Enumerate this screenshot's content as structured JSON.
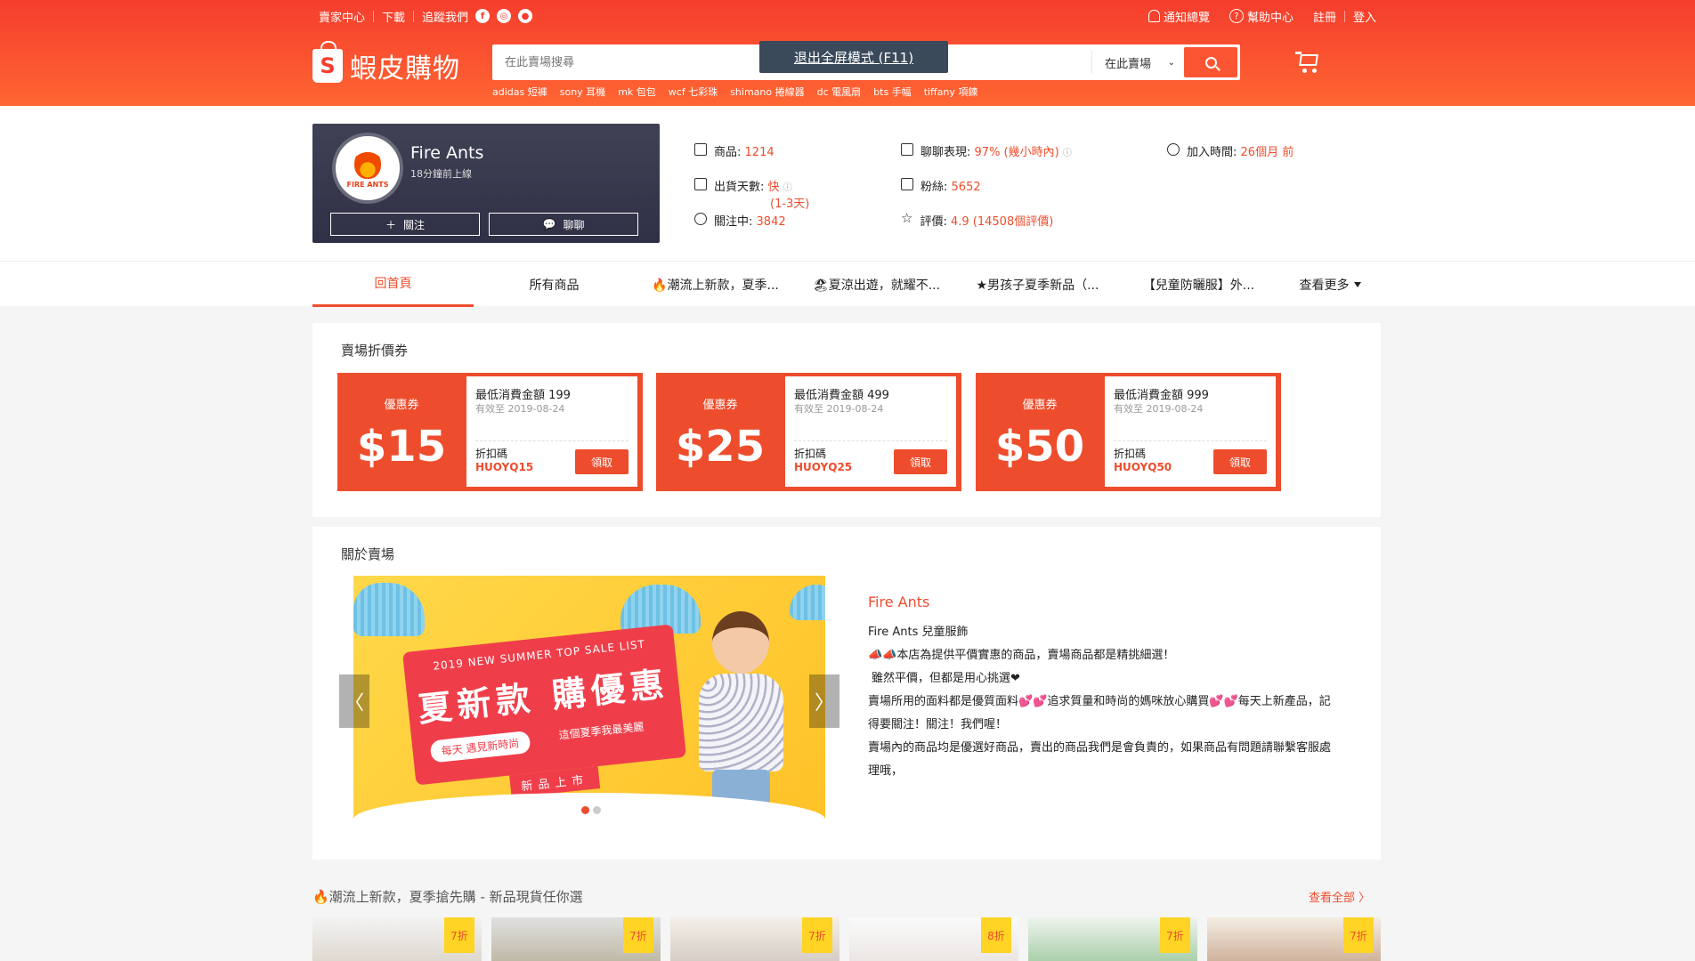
{
  "topbar": {
    "left": [
      "賣家中心",
      "下載",
      "追蹤我們"
    ],
    "social": [
      "f",
      "◎",
      "●"
    ],
    "notify": "通知總覽",
    "help": "幫助中心",
    "register": "註冊",
    "login": "登入"
  },
  "logo": {
    "mark": "S",
    "text": "蝦皮購物"
  },
  "search": {
    "placeholder": "在此賣場搜尋",
    "scope": "在此賣場",
    "fullscreen_tip": "退出全屏模式 (F11)",
    "keywords": [
      "adidas 短褲",
      "sony 耳機",
      "mk 包包",
      "wcf 七彩珠",
      "shimano 捲線器",
      "dc 電風扇",
      "bts 手幅",
      "tiffany 項鍊"
    ]
  },
  "shop": {
    "avatar_text": "FIRE ANTS",
    "name": "Fire Ants",
    "online": "18分鐘前上線",
    "follow_label": "關注",
    "chat_label": "聊聊",
    "stats": {
      "products_label": "商品:",
      "products_value": "1214",
      "ship_label": "出貨天數:",
      "ship_value": "快",
      "ship_days": "(1-3天)",
      "following_label": "關注中:",
      "following_value": "3842",
      "chat_label": "聊聊表現:",
      "chat_value": "97% (幾小時內)",
      "fans_label": "粉絲:",
      "fans_value": "5652",
      "rating_label": "評價:",
      "rating_value": "4.9 (14508個評價)",
      "joined_label": "加入時間:",
      "joined_value": "26個月 前"
    }
  },
  "nav": {
    "tabs": [
      "回首頁",
      "所有商品",
      "🔥潮流上新款，夏季...",
      "🏖夏涼出遊，就耀不...",
      "★男孩子夏季新品（...",
      "【兒童防曬服】外...",
      "查看更多"
    ]
  },
  "vouchers": {
    "title": "賣場折價券",
    "items": [
      {
        "label": "優惠券",
        "amount": "$15",
        "min": "最低消費金額 199",
        "valid": "有效至 2019-08-24",
        "code_label": "折扣碼",
        "code": "HUOYQ15",
        "claim": "領取"
      },
      {
        "label": "優惠券",
        "amount": "$25",
        "min": "最低消費金額 499",
        "valid": "有效至 2019-08-24",
        "code_label": "折扣碼",
        "code": "HUOYQ25",
        "claim": "領取"
      },
      {
        "label": "優惠券",
        "amount": "$50",
        "min": "最低消費金額 999",
        "valid": "有效至 2019-08-24",
        "code_label": "折扣碼",
        "code": "HUOYQ50",
        "claim": "領取"
      }
    ]
  },
  "about": {
    "title": "關於賣場",
    "banner": {
      "line1": "2019 NEW SUMMER TOP SALE LIST",
      "line2": "夏新款 購優惠",
      "line3": "每天 遇見新時尚",
      "line4": "這個夏季我最美麗",
      "line5": "新品上市"
    },
    "name": "Fire Ants",
    "desc": [
      "Fire Ants 兒童服飾",
      "📣📣本店為提供平價實惠的商品，賣場商品都是精挑細選！",
      "雖然平價，但都是用心挑選❤",
      "賣場所用的面料都是優質面料💕💕追求質量和時尚的媽咪放心購買💕💕每天上新產品，記得要關注！關注！我們喔！",
      "賣場內的商品均是優選好商品，賣出的商品我們是會負責的，如果商品有問題請聯繫客服處理哦，"
    ]
  },
  "products": {
    "title": "🔥潮流上新款，夏季搶先購 - 新品現貨任你選",
    "view_all": "查看全部 〉",
    "discounts": [
      "7折",
      "7折",
      "7折",
      "8折",
      "7折",
      "7折"
    ]
  },
  "colors": {
    "brand": "#ee4d2d",
    "header_start": "#f53d2d",
    "header_end": "#ff6633"
  }
}
